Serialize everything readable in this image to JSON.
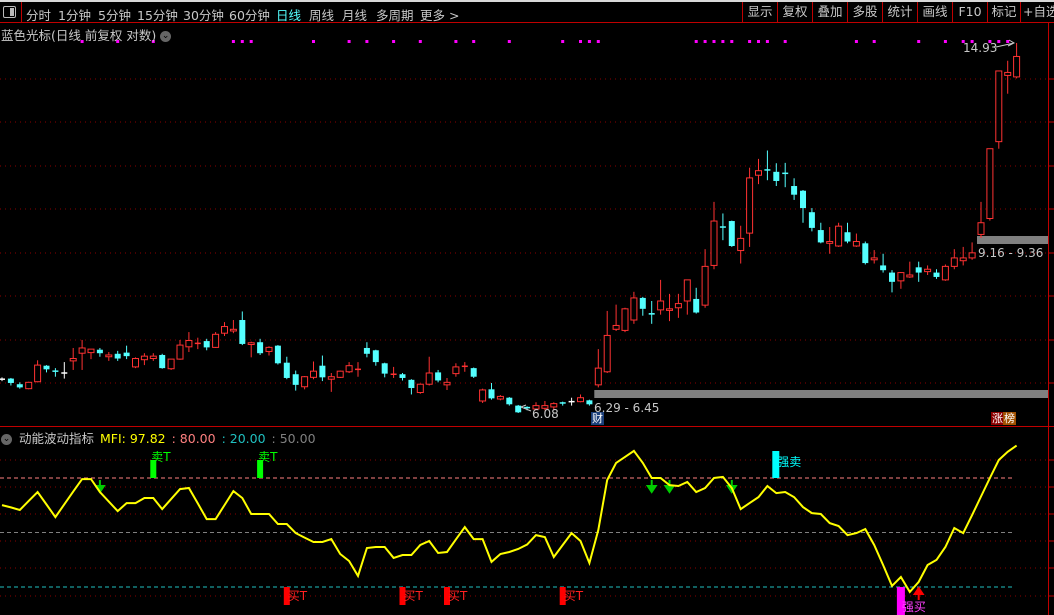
{
  "toolbar": {
    "periods": [
      "分时",
      "1分钟",
      "5分钟",
      "15分钟",
      "30分钟",
      "60分钟",
      "日线",
      "周线",
      "月线",
      "多周期",
      "更多 >"
    ],
    "active_period": "日线",
    "buttons": [
      "显示",
      "复权",
      "叠加",
      "多股",
      "统计",
      "画线",
      "F10",
      "标记",
      "+自选"
    ]
  },
  "main_panel": {
    "title": "蓝色光标(日线 前复权 对数)",
    "high_label": "14.93",
    "low_label": "6.08",
    "range_label_1": "6.29 - 6.45",
    "range_label_2": "9.16 - 9.36",
    "badge_cai": "财",
    "badge_zhang": "涨",
    "badge_bang": "榜"
  },
  "indicator_panel": {
    "name": "动能波动指标",
    "mfi_label": "MFI: 97.82",
    "level_80": ": 80.00",
    "level_20": ": 20.00",
    "level_50": ": 50.00",
    "sell_t_label": "卖T",
    "buy_t_label": "买T",
    "strong_sell_label": "强卖",
    "strong_buy_label": "强买"
  },
  "colors": {
    "up": "#ff3232",
    "down": "#54ffff",
    "flat": "#ffffff",
    "mfi": "#ffff00",
    "level80": "#ff8080",
    "level20": "#20c0c0",
    "level50": "#808080",
    "marker": "#ff00ff",
    "grid": "#8b0000"
  },
  "chart_data": [
    {
      "type": "candlestick",
      "scale": "log",
      "ohlc_fields": [
        "open",
        "high",
        "low",
        "close"
      ],
      "candles": [
        [
          6.6,
          6.63,
          6.57,
          6.6
        ],
        [
          6.61,
          6.62,
          6.5,
          6.54
        ],
        [
          6.52,
          6.55,
          6.45,
          6.47
        ],
        [
          6.45,
          6.56,
          6.44,
          6.55
        ],
        [
          6.56,
          6.91,
          6.55,
          6.83
        ],
        [
          6.82,
          6.83,
          6.71,
          6.76
        ],
        [
          6.73,
          6.78,
          6.64,
          6.72
        ],
        [
          6.7,
          6.88,
          6.61,
          6.7
        ],
        [
          6.9,
          7.12,
          6.75,
          6.94
        ],
        [
          7.03,
          7.26,
          6.75,
          7.12
        ],
        [
          7.04,
          7.1,
          6.93,
          7.1
        ],
        [
          7.09,
          7.12,
          6.97,
          7.03
        ],
        [
          6.97,
          7.05,
          6.9,
          7.0
        ],
        [
          7.02,
          7.07,
          6.9,
          6.94
        ],
        [
          7.04,
          7.16,
          6.93,
          6.98
        ],
        [
          6.8,
          6.96,
          6.78,
          6.94
        ],
        [
          6.92,
          7.03,
          6.83,
          6.98
        ],
        [
          6.94,
          7.03,
          6.9,
          6.98
        ],
        [
          7.0,
          7.02,
          6.77,
          6.78
        ],
        [
          6.77,
          6.93,
          6.75,
          6.93
        ],
        [
          6.93,
          7.26,
          6.92,
          7.17
        ],
        [
          7.14,
          7.4,
          7.05,
          7.25
        ],
        [
          7.18,
          7.3,
          7.1,
          7.2
        ],
        [
          7.24,
          7.28,
          7.08,
          7.13
        ],
        [
          7.13,
          7.4,
          7.12,
          7.36
        ],
        [
          7.38,
          7.58,
          7.33,
          7.5
        ],
        [
          7.42,
          7.62,
          7.38,
          7.45
        ],
        [
          7.62,
          7.78,
          7.17,
          7.19
        ],
        [
          7.18,
          7.23,
          6.96,
          7.21
        ],
        [
          7.22,
          7.28,
          7.0,
          7.03
        ],
        [
          7.06,
          7.15,
          6.99,
          7.13
        ],
        [
          7.16,
          7.17,
          6.84,
          6.86
        ],
        [
          6.87,
          6.97,
          6.6,
          6.62
        ],
        [
          6.68,
          6.74,
          6.42,
          6.51
        ],
        [
          6.48,
          6.65,
          6.44,
          6.64
        ],
        [
          6.63,
          6.89,
          6.6,
          6.73
        ],
        [
          6.82,
          6.99,
          6.57,
          6.63
        ],
        [
          6.6,
          6.7,
          6.4,
          6.64
        ],
        [
          6.63,
          6.74,
          6.62,
          6.73
        ],
        [
          6.72,
          6.88,
          6.7,
          6.82
        ],
        [
          6.74,
          6.88,
          6.64,
          6.76
        ],
        [
          7.12,
          7.22,
          6.96,
          7.02
        ],
        [
          7.08,
          7.09,
          6.82,
          6.88
        ],
        [
          6.86,
          6.87,
          6.63,
          6.69
        ],
        [
          6.66,
          6.8,
          6.62,
          6.68
        ],
        [
          6.68,
          6.7,
          6.58,
          6.62
        ],
        [
          6.59,
          6.6,
          6.36,
          6.46
        ],
        [
          6.39,
          6.53,
          6.37,
          6.52
        ],
        [
          6.52,
          6.97,
          6.5,
          6.7
        ],
        [
          6.71,
          6.75,
          6.55,
          6.58
        ],
        [
          6.51,
          6.62,
          6.43,
          6.55
        ],
        [
          6.69,
          6.86,
          6.64,
          6.8
        ],
        [
          6.79,
          6.88,
          6.72,
          6.81
        ],
        [
          6.78,
          6.79,
          6.62,
          6.64
        ],
        [
          6.26,
          6.45,
          6.23,
          6.43
        ],
        [
          6.44,
          6.54,
          6.28,
          6.3
        ],
        [
          6.29,
          6.35,
          6.27,
          6.33
        ],
        [
          6.31,
          6.32,
          6.19,
          6.21
        ],
        [
          6.19,
          6.2,
          6.08,
          6.09
        ],
        [
          6.16,
          6.18,
          6.12,
          6.15
        ],
        [
          6.14,
          6.24,
          6.12,
          6.19
        ],
        [
          6.15,
          6.26,
          6.12,
          6.19
        ],
        [
          6.17,
          6.24,
          6.13,
          6.22
        ],
        [
          6.23,
          6.25,
          6.19,
          6.22
        ],
        [
          6.25,
          6.31,
          6.19,
          6.25
        ],
        [
          6.25,
          6.36,
          6.24,
          6.31
        ],
        [
          6.27,
          6.28,
          6.19,
          6.21
        ],
        [
          6.51,
          7.1,
          6.47,
          6.78
        ],
        [
          6.72,
          7.79,
          6.7,
          7.34
        ],
        [
          7.45,
          7.91,
          7.42,
          7.52
        ],
        [
          7.43,
          7.85,
          7.4,
          7.83
        ],
        [
          7.62,
          8.16,
          7.55,
          8.04
        ],
        [
          8.04,
          8.06,
          7.7,
          7.83
        ],
        [
          7.75,
          7.98,
          7.55,
          7.72
        ],
        [
          7.81,
          8.4,
          7.72,
          7.98
        ],
        [
          7.8,
          8.12,
          7.6,
          7.83
        ],
        [
          7.85,
          8.12,
          7.66,
          7.93
        ],
        [
          7.98,
          8.4,
          7.72,
          8.4
        ],
        [
          8.02,
          8.24,
          7.74,
          7.76
        ],
        [
          7.9,
          9.05,
          7.85,
          8.68
        ],
        [
          8.7,
          10.15,
          8.62,
          9.69
        ],
        [
          9.55,
          9.87,
          9.25,
          9.53
        ],
        [
          9.69,
          9.7,
          9.1,
          9.12
        ],
        [
          9.02,
          9.58,
          8.74,
          9.29
        ],
        [
          9.41,
          11.03,
          9.1,
          10.76
        ],
        [
          10.83,
          11.27,
          10.6,
          10.95
        ],
        [
          10.97,
          11.5,
          10.7,
          10.96
        ],
        [
          10.92,
          11.15,
          10.55,
          10.68
        ],
        [
          10.88,
          11.16,
          10.52,
          10.87
        ],
        [
          10.55,
          10.75,
          10.2,
          10.33
        ],
        [
          10.43,
          10.45,
          9.65,
          10.0
        ],
        [
          9.9,
          10.0,
          9.45,
          9.53
        ],
        [
          9.48,
          9.65,
          9.18,
          9.2
        ],
        [
          9.18,
          9.55,
          8.95,
          9.22
        ],
        [
          9.12,
          9.65,
          9.1,
          9.57
        ],
        [
          9.43,
          9.65,
          9.18,
          9.22
        ],
        [
          9.12,
          9.4,
          9.1,
          9.22
        ],
        [
          9.18,
          9.22,
          8.72,
          8.75
        ],
        [
          8.82,
          9.03,
          8.74,
          8.86
        ],
        [
          8.7,
          8.95,
          8.55,
          8.6
        ],
        [
          8.55,
          8.6,
          8.15,
          8.36
        ],
        [
          8.38,
          8.56,
          8.22,
          8.55
        ],
        [
          8.46,
          8.78,
          8.44,
          8.5
        ],
        [
          8.66,
          8.78,
          8.36,
          8.55
        ],
        [
          8.57,
          8.7,
          8.5,
          8.62
        ],
        [
          8.55,
          8.62,
          8.42,
          8.46
        ],
        [
          8.4,
          8.72,
          8.38,
          8.68
        ],
        [
          8.68,
          9.05,
          8.62,
          8.86
        ],
        [
          8.8,
          9.1,
          8.7,
          8.86
        ],
        [
          8.86,
          9.2,
          8.82,
          8.97
        ],
        [
          9.38,
          10.15,
          9.3,
          9.65
        ],
        [
          9.75,
          11.55,
          9.7,
          11.55
        ],
        [
          11.75,
          13.95,
          11.55,
          13.95
        ],
        [
          13.8,
          14.3,
          13.2,
          13.9
        ],
        [
          13.75,
          14.93,
          13.7,
          14.45
        ]
      ],
      "ylim": [
        6.08,
        14.93
      ],
      "signal_marker_candles": [
        9,
        13,
        17,
        26,
        27,
        28,
        35,
        39,
        41,
        44,
        47,
        51,
        53,
        57,
        63,
        65,
        66,
        67,
        78,
        79,
        80,
        81,
        82,
        84,
        85,
        86,
        88,
        96,
        98,
        103,
        106,
        108,
        109,
        111,
        112,
        113
      ],
      "price_bands": [
        {
          "from": 6.29,
          "to": 6.45,
          "start_candle": 67
        },
        {
          "from": 9.16,
          "to": 9.36,
          "start_candle": 110
        }
      ],
      "grid": true
    },
    {
      "type": "line",
      "name": "MFI",
      "ylim": [
        0,
        100
      ],
      "levels": [
        80,
        50,
        20
      ],
      "values": [
        65.1,
        63.8,
        62.4,
        67.4,
        72.3,
        65.4,
        58.5,
        65.5,
        72.5,
        79.4,
        79.4,
        72.3,
        67.0,
        61.8,
        66.2,
        66.2,
        69.0,
        69.0,
        62.9,
        68.4,
        73.9,
        74.5,
        66.0,
        57.4,
        57.4,
        65.1,
        72.8,
        69.0,
        60.2,
        60.2,
        60.2,
        54.7,
        54.7,
        49.7,
        47.2,
        44.8,
        44.8,
        46.4,
        38.2,
        34.3,
        26.1,
        41.5,
        42.0,
        42.0,
        36.0,
        37.6,
        37.6,
        43.1,
        45.3,
        38.7,
        39.3,
        46.2,
        53.0,
        46.4,
        46.4,
        33.8,
        38.2,
        39.3,
        40.9,
        43.4,
        48.6,
        47.5,
        36.5,
        43.1,
        49.7,
        45.3,
        33.2,
        51.4,
        78.9,
        88.3,
        91.6,
        94.9,
        88.3,
        80.0,
        80.0,
        76.1,
        75.6,
        77.8,
        72.3,
        74.5,
        80.0,
        80.6,
        74.5,
        62.9,
        66.2,
        69.5,
        75.6,
        71.7,
        72.3,
        69.5,
        64.0,
        60.7,
        60.2,
        55.2,
        53.6,
        48.6,
        49.7,
        51.9,
        43.1,
        32.1,
        20.6,
        25.5,
        17.3,
        22.8,
        32.1,
        34.9,
        42.0,
        52.5,
        49.7,
        59.6,
        69.8,
        80.0,
        89.9,
        94.4,
        97.82
      ],
      "signals": {
        "sell_t": [
          17,
          29
        ],
        "buy_t": [
          32,
          45,
          50,
          63
        ],
        "down_arrow": [
          11,
          73,
          75,
          82
        ],
        "up_arrow": [
          103
        ],
        "strong_sell": [
          87
        ],
        "strong_buy": [
          101
        ]
      }
    }
  ]
}
